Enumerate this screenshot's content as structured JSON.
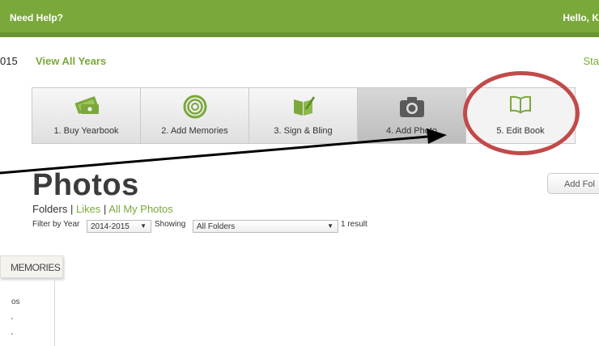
{
  "header": {
    "help": "Need Help?",
    "greeting": "Hello, K"
  },
  "years": {
    "current": "015",
    "view_all": "View All Years",
    "right": "Sta"
  },
  "steps": [
    {
      "label": "1. Buy Yearbook"
    },
    {
      "label": "2. Add Memories"
    },
    {
      "label": "3. Sign & Bling"
    },
    {
      "label": "4. Add Photo"
    },
    {
      "label": "5. Edit Book"
    }
  ],
  "page": {
    "title": "Photos",
    "add_folder": "Add Fol"
  },
  "sublinks": {
    "folders": "Folders",
    "likes": "Likes",
    "all": "All My Photos",
    "sep": "|"
  },
  "filter": {
    "label": "Filter by Year",
    "year": "2014-2015",
    "showing": "Showing",
    "folder": "All Folders",
    "result": "1 result"
  },
  "sidebar": {
    "tag": "MEMORIES",
    "item1": "os",
    "item2": "'",
    "item3": "'"
  },
  "colors": {
    "green": "#7aa83a",
    "annotation_red": "#c24a4a"
  }
}
